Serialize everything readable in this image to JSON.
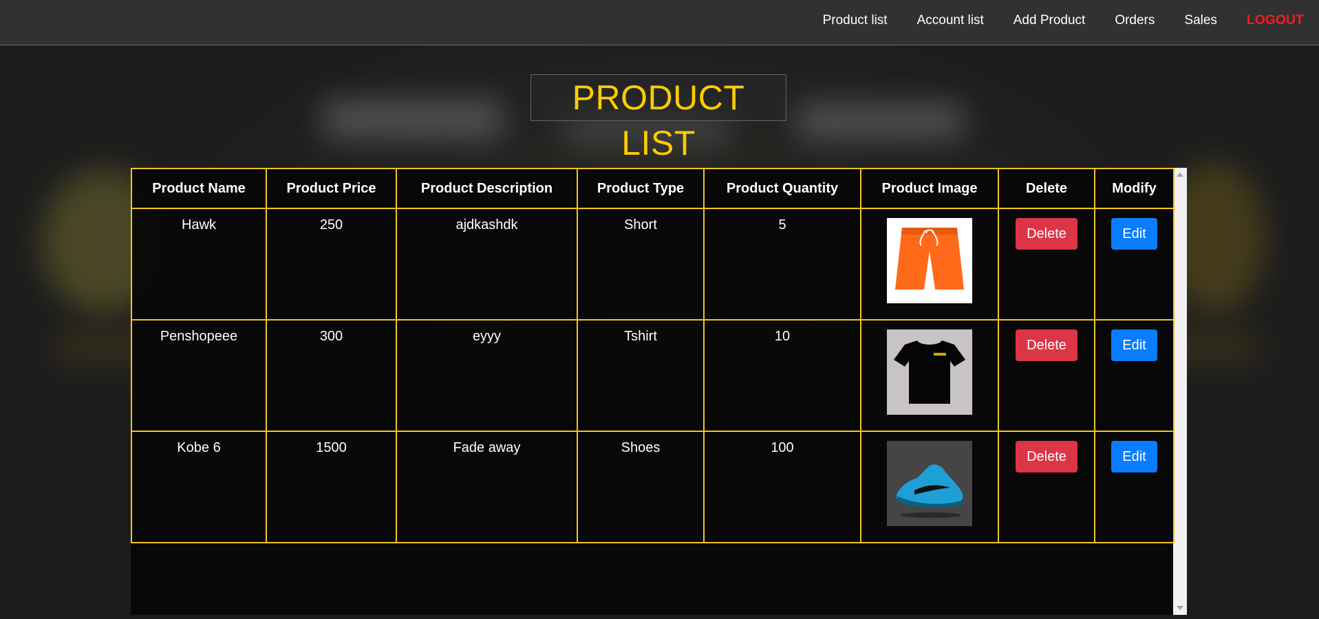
{
  "nav": {
    "items": [
      {
        "label": "Product list"
      },
      {
        "label": "Account list"
      },
      {
        "label": "Add Product"
      },
      {
        "label": "Orders"
      },
      {
        "label": "Sales"
      }
    ],
    "logout_label": "LOGOUT"
  },
  "page_title": "PRODUCT LIST",
  "table": {
    "headers": [
      "Product Name",
      "Product Price",
      "Product Description",
      "Product Type",
      "Product Quantity",
      "Product Image",
      "Delete",
      "Modify"
    ],
    "rows": [
      {
        "name": "Hawk",
        "price": "250",
        "description": "ajdkashdk",
        "type": "Short",
        "quantity": "5",
        "image": "orange-shorts",
        "delete_label": "Delete",
        "edit_label": "Edit"
      },
      {
        "name": "Penshopeee",
        "price": "300",
        "description": "eyyy",
        "type": "Tshirt",
        "quantity": "10",
        "image": "black-tshirt",
        "delete_label": "Delete",
        "edit_label": "Edit"
      },
      {
        "name": "Kobe 6",
        "price": "1500",
        "description": "Fade away",
        "type": "Shoes",
        "quantity": "100",
        "image": "blue-shoe",
        "delete_label": "Delete",
        "edit_label": "Edit"
      }
    ]
  },
  "colors": {
    "accent": "#ffcc00",
    "table_border": "#f3c61d",
    "logout": "#ff1a1a",
    "delete_button": "#dc3545",
    "edit_button": "#0a7cff"
  }
}
